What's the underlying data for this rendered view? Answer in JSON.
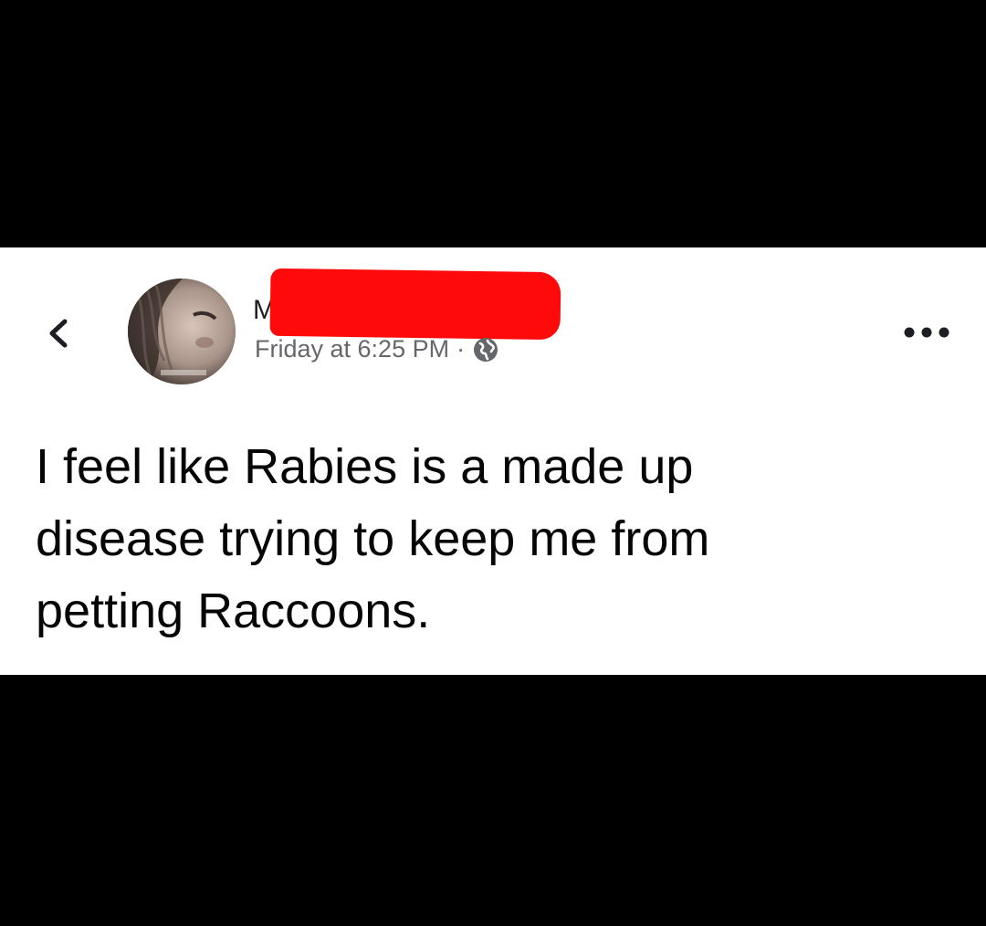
{
  "post": {
    "author_name_visible": "M",
    "timestamp": "Friday at 6:25 PM",
    "separator": "·",
    "body_lines": [
      "I feel like Rabies is a made up",
      "disease trying to keep me from",
      "petting Raccoons."
    ]
  },
  "icons": {
    "back": "chevron-left-icon",
    "more": "more-horizontal-icon",
    "privacy": "globe-icon"
  },
  "colors": {
    "background": "#000000",
    "card": "#ffffff",
    "redaction": "#ff0a0a",
    "meta_text": "#65676b",
    "body_text": "#050505"
  }
}
